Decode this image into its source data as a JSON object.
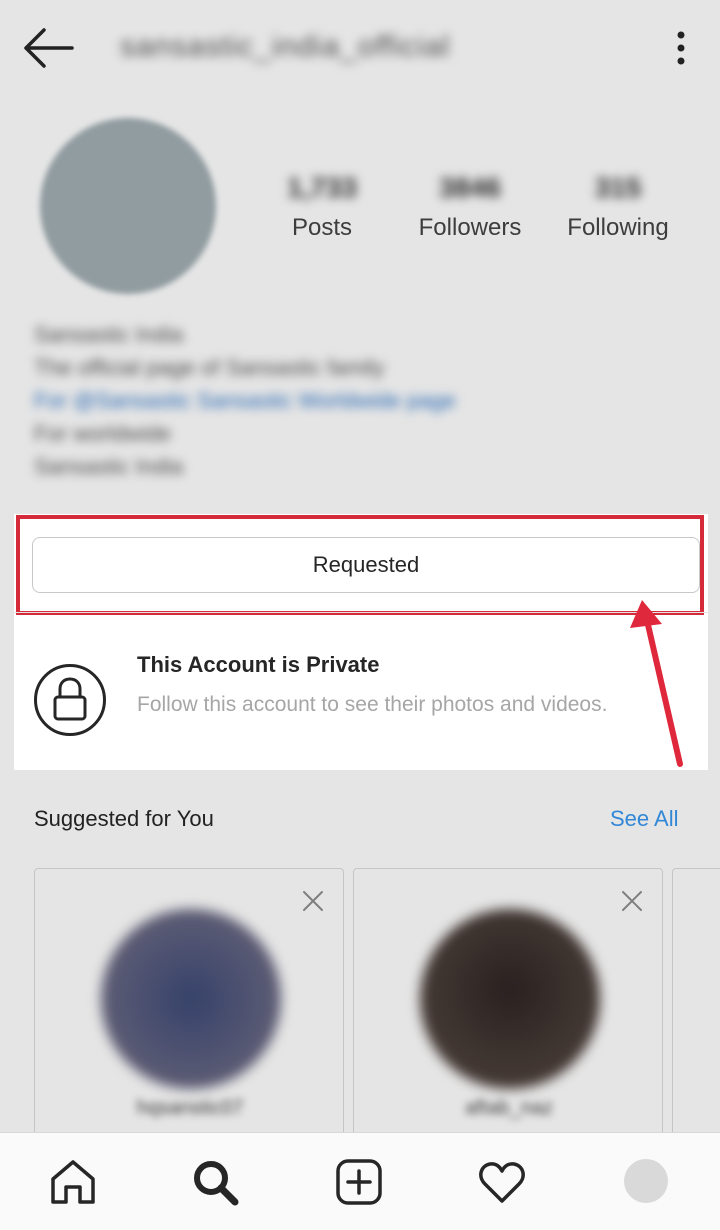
{
  "header": {
    "username": "sansastic_india_official",
    "back_icon": "arrow-left-icon",
    "more_icon": "more-vertical-icon"
  },
  "profile": {
    "stats": [
      {
        "num": "1,733",
        "label": "Posts"
      },
      {
        "num": "3846",
        "label": "Followers"
      },
      {
        "num": "315",
        "label": "Following"
      }
    ],
    "bio_lines": [
      "Sansastic India",
      "The official page of Sansastic family",
      "For @Sansastic Sansastic Worldwide page",
      "For worldwide",
      "Sansastic India"
    ]
  },
  "private_panel": {
    "button_label": "Requested",
    "title": "This Account is Private",
    "description": "Follow this account to see their photos and videos.",
    "highlight_color": "#d42a3a"
  },
  "suggested": {
    "title": "Suggested for You",
    "see_all": "See All",
    "cards": [
      {
        "name": "hqsanstic07"
      },
      {
        "name": "aftab_naz"
      }
    ]
  },
  "nav": {
    "items": [
      "home-icon",
      "search-icon",
      "add-post-icon",
      "activity-heart-icon",
      "profile-avatar"
    ]
  },
  "colors": {
    "accent": "#3897f0",
    "annotation": "#d42a3a"
  }
}
